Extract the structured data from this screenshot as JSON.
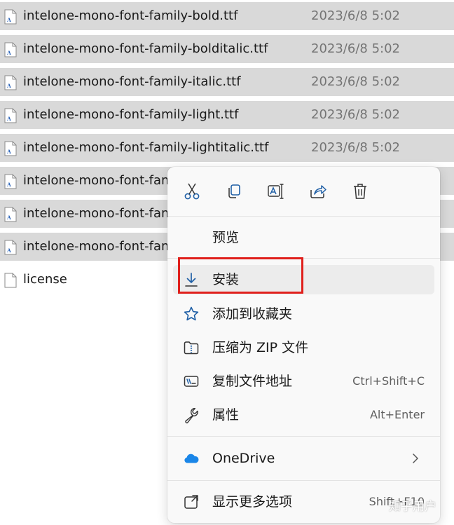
{
  "files": [
    {
      "name": "intelone-mono-font-family-bold.ttf",
      "date": "2023/6/8 5:02",
      "selected": true
    },
    {
      "name": "intelone-mono-font-family-bolditalic.ttf",
      "date": "2023/6/8 5:02",
      "selected": true
    },
    {
      "name": "intelone-mono-font-family-italic.ttf",
      "date": "2023/6/8 5:02",
      "selected": true
    },
    {
      "name": "intelone-mono-font-family-light.ttf",
      "date": "2023/6/8 5:02",
      "selected": true
    },
    {
      "name": "intelone-mono-font-family-lightitalic.ttf",
      "date": "2023/6/8 5:02",
      "selected": true
    },
    {
      "name": "intelone-mono-font-fam",
      "date": "",
      "selected": true
    },
    {
      "name": "intelone-mono-font-fam",
      "date": "",
      "selected": true
    },
    {
      "name": "intelone-mono-font-fam",
      "date": "",
      "selected": true
    },
    {
      "name": "license",
      "date": "",
      "selected": false
    }
  ],
  "file_icons": [
    "font-file-icon",
    "font-file-icon",
    "font-file-icon",
    "font-file-icon",
    "font-file-icon",
    "font-file-icon",
    "font-file-icon",
    "font-file-icon",
    "document-icon"
  ],
  "context_menu": {
    "toolbar": [
      {
        "action": "cut",
        "icon": "scissors-icon"
      },
      {
        "action": "copy",
        "icon": "copy-icon"
      },
      {
        "action": "rename",
        "icon": "rename-icon"
      },
      {
        "action": "share",
        "icon": "share-icon"
      },
      {
        "action": "delete",
        "icon": "trash-icon"
      }
    ],
    "items": {
      "preview": {
        "label": "预览"
      },
      "install": {
        "label": "安装",
        "icon": "download-icon"
      },
      "favorites": {
        "label": "添加到收藏夹",
        "icon": "star-icon"
      },
      "zip": {
        "label": "压缩为 ZIP 文件",
        "icon": "zip-folder-icon"
      },
      "copy_path": {
        "label": "复制文件地址",
        "shortcut": "Ctrl+Shift+C",
        "icon": "copy-path-icon"
      },
      "properties": {
        "label": "属性",
        "shortcut": "Alt+Enter",
        "icon": "wrench-icon"
      },
      "onedrive": {
        "label": "OneDrive",
        "icon": "onedrive-cloud-icon"
      },
      "more_options": {
        "label": "显示更多选项",
        "shortcut": "Shift+F10",
        "icon": "more-options-icon"
      }
    }
  },
  "watermark": "知乎用户",
  "colors": {
    "selection": "#d9d9d9",
    "menu_bg": "#f9f9f9",
    "highlight_box": "#e0201c",
    "icon_blue": "#0a64c8",
    "onedrive_blue": "#1a86e8"
  }
}
